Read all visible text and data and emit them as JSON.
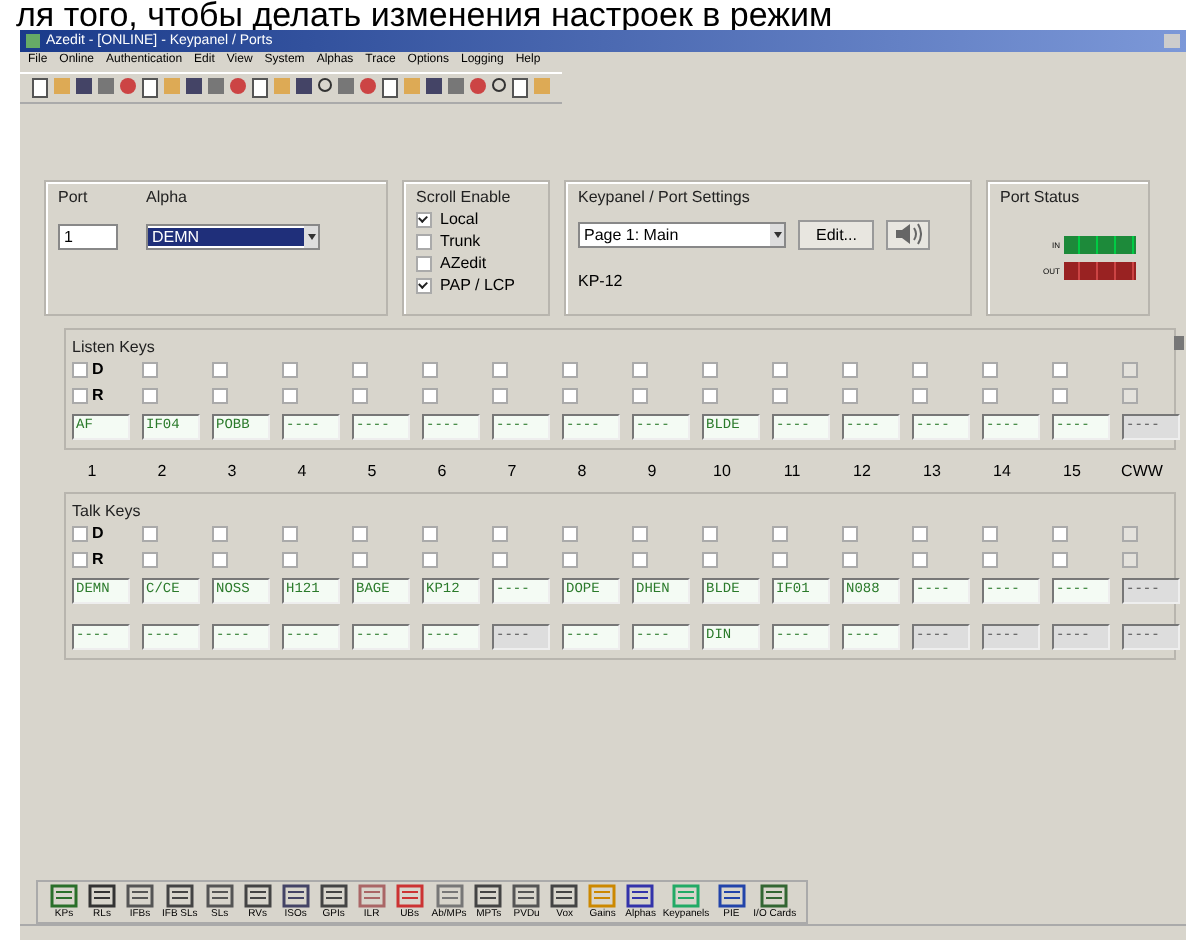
{
  "caption": "ля того,  чтобы делать изменения настроек в режим",
  "window": {
    "title": "Azedit - [ONLINE] - Keypanel / Ports"
  },
  "menu": [
    "File",
    "Online",
    "Authentication",
    "Edit",
    "View",
    "System",
    "Alphas",
    "Trace",
    "Options",
    "Logging",
    "Help"
  ],
  "port": {
    "label": "Port",
    "value": "1"
  },
  "alpha": {
    "label": "Alpha",
    "value": "DEMN"
  },
  "scroll_enable": {
    "title": "Scroll Enable",
    "options": [
      {
        "label": "Local",
        "checked": true
      },
      {
        "label": "Trunk",
        "checked": false
      },
      {
        "label": "AZedit",
        "checked": false
      },
      {
        "label": "PAP / LCP",
        "checked": true
      }
    ]
  },
  "keypanel_settings": {
    "title": "Keypanel / Port Settings",
    "page": "Page 1: Main",
    "edit_button": "Edit...",
    "panel_type": "KP-12"
  },
  "port_status": {
    "title": "Port Status",
    "rows": [
      "IN",
      "OUT"
    ]
  },
  "listen_keys": {
    "title": "Listen Keys",
    "row_labels": [
      "D",
      "R"
    ],
    "keys": [
      {
        "value": "AF",
        "disabled": false,
        "d": false,
        "r": false
      },
      {
        "value": "IF04",
        "disabled": false,
        "d": false,
        "r": false
      },
      {
        "value": "POBB",
        "disabled": false,
        "d": false,
        "r": false
      },
      {
        "value": "----",
        "disabled": false,
        "d": false,
        "r": false
      },
      {
        "value": "----",
        "disabled": false,
        "d": false,
        "r": false
      },
      {
        "value": "----",
        "disabled": false,
        "d": false,
        "r": false
      },
      {
        "value": "----",
        "disabled": false,
        "d": false,
        "r": false
      },
      {
        "value": "----",
        "disabled": false,
        "d": false,
        "r": false
      },
      {
        "value": "----",
        "disabled": false,
        "d": false,
        "r": false
      },
      {
        "value": "BLDE",
        "disabled": false,
        "d": false,
        "r": false
      },
      {
        "value": "----",
        "disabled": false,
        "d": false,
        "r": false
      },
      {
        "value": "----",
        "disabled": false,
        "d": false,
        "r": false
      },
      {
        "value": "----",
        "disabled": false,
        "d": false,
        "r": false
      },
      {
        "value": "----",
        "disabled": false,
        "d": false,
        "r": false
      },
      {
        "value": "----",
        "disabled": false,
        "d": false,
        "r": false
      },
      {
        "value": "----",
        "disabled": true,
        "d": false,
        "r": false
      }
    ]
  },
  "columns": [
    "1",
    "2",
    "3",
    "4",
    "5",
    "6",
    "7",
    "8",
    "9",
    "10",
    "11",
    "12",
    "13",
    "14",
    "15",
    "CWW"
  ],
  "talk_keys": {
    "title": "Talk Keys",
    "row_labels": [
      "D",
      "R"
    ],
    "keys": [
      {
        "value": "DEMN",
        "disabled": false,
        "value_2": "----",
        "disabled_2": false,
        "d": false,
        "r": false
      },
      {
        "value": "C/CE",
        "disabled": false,
        "value_2": "----",
        "disabled_2": false,
        "d": false,
        "r": false
      },
      {
        "value": "NOSS",
        "disabled": false,
        "value_2": "----",
        "disabled_2": false,
        "d": false,
        "r": false
      },
      {
        "value": "H121",
        "disabled": false,
        "value_2": "----",
        "disabled_2": false,
        "d": false,
        "r": false
      },
      {
        "value": "BAGE",
        "disabled": false,
        "value_2": "----",
        "disabled_2": false,
        "d": false,
        "r": false
      },
      {
        "value": "KP12",
        "disabled": false,
        "value_2": "----",
        "disabled_2": false,
        "d": false,
        "r": false
      },
      {
        "value": "----",
        "disabled": false,
        "value_2": "----",
        "disabled_2": true,
        "d": false,
        "r": false
      },
      {
        "value": "DOPE",
        "disabled": false,
        "value_2": "----",
        "disabled_2": false,
        "d": false,
        "r": false
      },
      {
        "value": "DHEN",
        "disabled": false,
        "value_2": "----",
        "disabled_2": false,
        "d": false,
        "r": false
      },
      {
        "value": "BLDE",
        "disabled": false,
        "value_2": "DIN",
        "disabled_2": false,
        "d": false,
        "r": false
      },
      {
        "value": "IF01",
        "disabled": false,
        "value_2": "----",
        "disabled_2": false,
        "d": false,
        "r": false
      },
      {
        "value": "N088",
        "disabled": false,
        "value_2": "----",
        "disabled_2": false,
        "d": false,
        "r": false
      },
      {
        "value": "----",
        "disabled": false,
        "value_2": "----",
        "disabled_2": true,
        "d": false,
        "r": false
      },
      {
        "value": "----",
        "disabled": false,
        "value_2": "----",
        "disabled_2": true,
        "d": false,
        "r": false
      },
      {
        "value": "----",
        "disabled": false,
        "value_2": "----",
        "disabled_2": true,
        "d": false,
        "r": false
      },
      {
        "value": "----",
        "disabled": true,
        "value_2": "----",
        "disabled_2": true,
        "d": false,
        "r": false
      }
    ]
  },
  "bottom_toolbar": [
    "KPs",
    "RLs",
    "IFBs",
    "IFB SLs",
    "SLs",
    "RVs",
    "ISOs",
    "GPIs",
    "ILR",
    "UBs",
    "Ab/MPs",
    "MPTs",
    "PVDu",
    "Vox",
    "Gains",
    "Alphas",
    "Keypanels",
    "PIE",
    "I/O Cards"
  ]
}
